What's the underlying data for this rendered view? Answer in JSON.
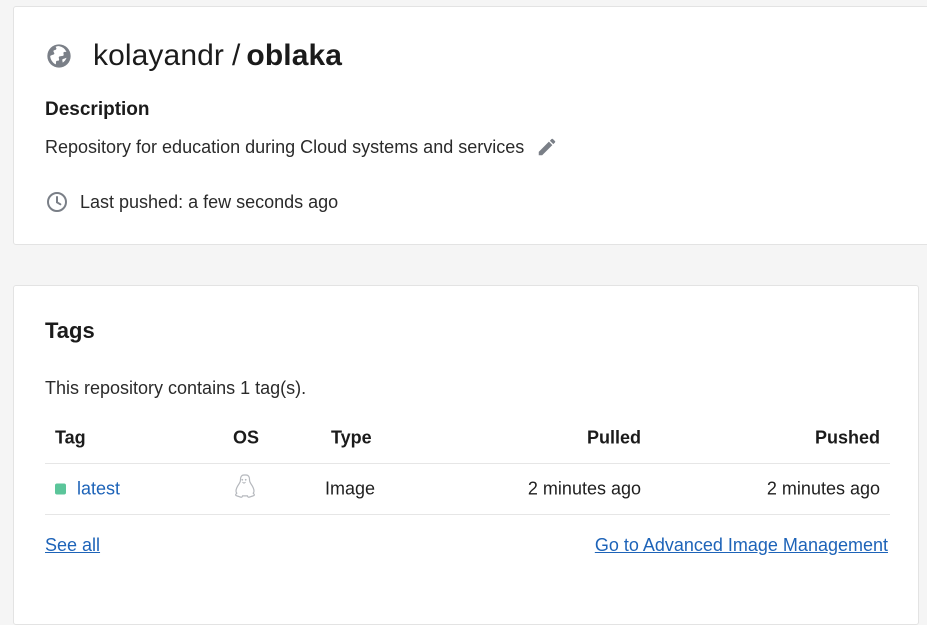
{
  "repository": {
    "owner": "kolayandr",
    "separator": "/",
    "name": "oblaka",
    "visibility_icon": "globe-icon",
    "description_heading": "Description",
    "description": "Repository for education during Cloud systems and services",
    "edit_icon": "pencil-icon",
    "last_pushed": "Last pushed: a few seconds ago",
    "clock_icon": "clock-icon"
  },
  "tags": {
    "heading": "Tags",
    "count_text": "This repository contains 1 tag(s).",
    "columns": {
      "tag": "Tag",
      "os": "OS",
      "type": "Type",
      "pulled": "Pulled",
      "pushed": "Pushed"
    },
    "rows": [
      {
        "tag": "latest",
        "status_color": "#5bc59a",
        "os_icon": "linux-icon",
        "type": "Image",
        "pulled": "2 minutes ago",
        "pushed": "2 minutes ago"
      }
    ],
    "see_all": "See all",
    "advanced_link": "Go to Advanced Image Management"
  },
  "colors": {
    "link": "#1d63b8",
    "background": "#f5f5f5",
    "status_active": "#5bc59a"
  }
}
